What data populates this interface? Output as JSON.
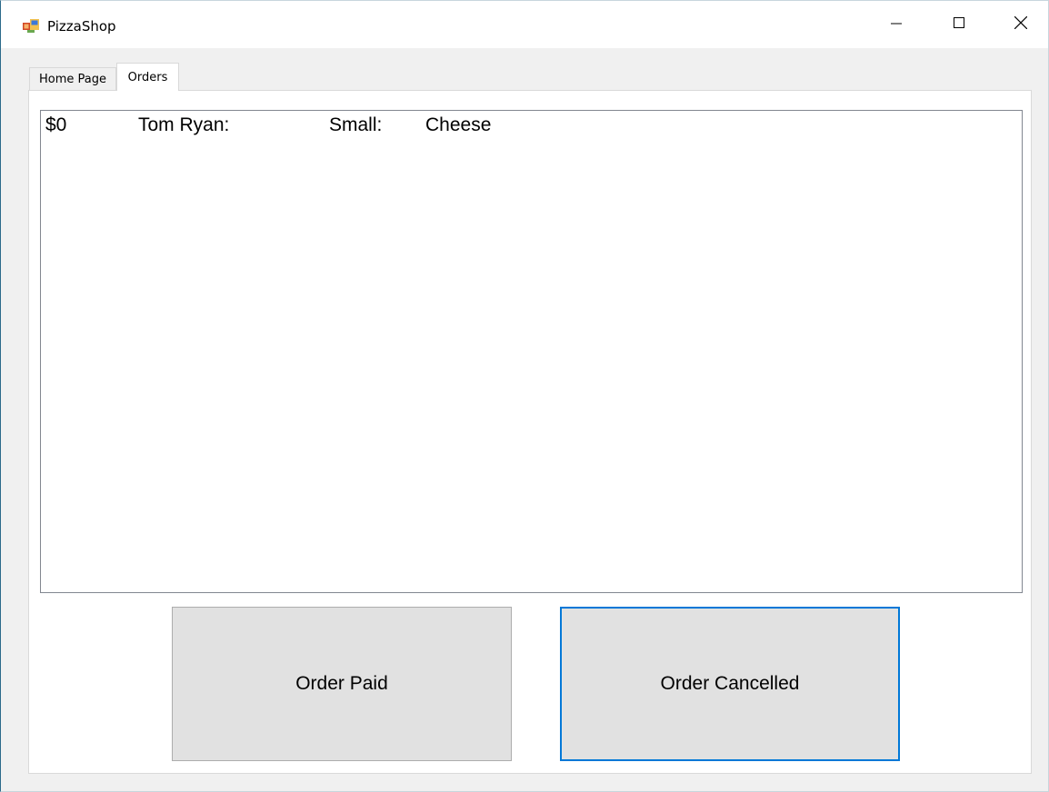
{
  "window": {
    "title": "PizzaShop",
    "controls": {
      "minimize": "minimize-icon",
      "maximize": "maximize-icon",
      "close": "close-icon"
    }
  },
  "tabs": [
    {
      "label": "Home Page",
      "selected": false
    },
    {
      "label": "Orders",
      "selected": true
    }
  ],
  "orders": {
    "items": [
      {
        "price": "$0",
        "name": "Tom Ryan:",
        "size": "Small:",
        "topping": "Cheese"
      }
    ]
  },
  "buttons": {
    "paid_label": "Order Paid",
    "cancelled_label": "Order Cancelled"
  },
  "colors": {
    "focus_border": "#0078d7",
    "button_face": "#e1e1e1",
    "window_bg": "#f0f0f0"
  }
}
